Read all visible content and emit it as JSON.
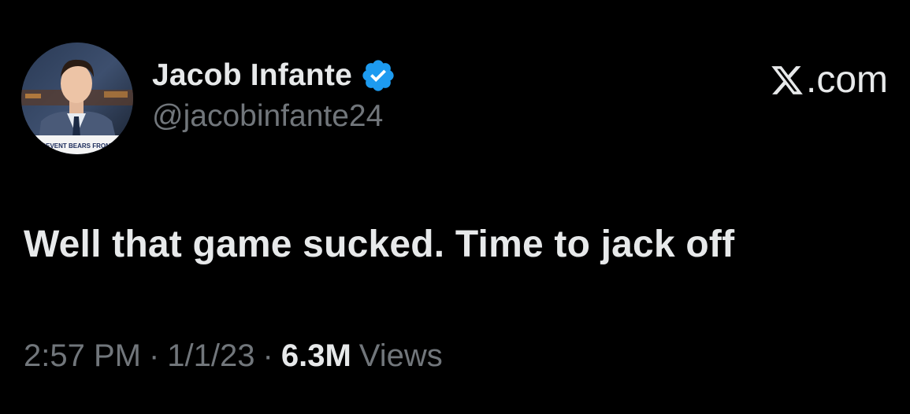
{
  "author": {
    "name": "Jacob Infante",
    "handle": "@jacobinfante24",
    "avatar_banner": "PREVENT BEARS FROM LEA",
    "verified_icon": "verified-badge-icon"
  },
  "brand": {
    "label": ".com",
    "icon": "x-logo-icon"
  },
  "tweet": {
    "text": "Well that game sucked. Time to jack off"
  },
  "meta": {
    "time": "2:57 PM",
    "separator": "·",
    "date": "1/1/23",
    "views_count": "6.3M",
    "views_label": "Views"
  },
  "colors": {
    "background": "#000000",
    "primary_text": "#e7e9ea",
    "secondary_text": "#71767b",
    "verified": "#1d9bf0"
  }
}
